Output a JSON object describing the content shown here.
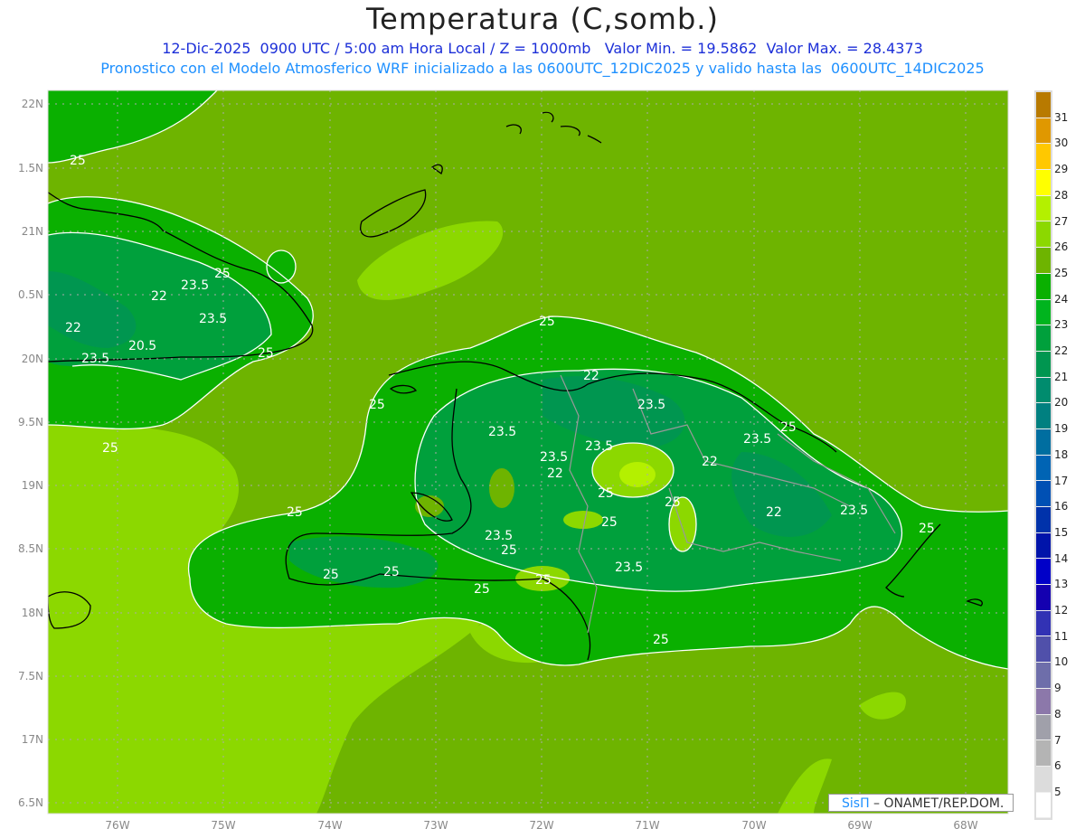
{
  "header": {
    "title": "Temperatura (C,somb.)",
    "line1": "12-Dic-2025  0900 UTC / 5:00 am Hora Local / Z = 1000mb   Valor Min. = 19.5862  Valor Max. = 28.4373",
    "line2": "Pronostico con el Modelo Atmosferico WRF inicializado a las 0600UTC_12DIC2025 y valido hasta las  0600UTC_14DIC2025"
  },
  "map": {
    "lat_labels": [
      "22N",
      "1.5N",
      "21N",
      "0.5N",
      "20N",
      "9.5N",
      "19N",
      "8.5N",
      "18N",
      "7.5N",
      "17N",
      "6.5N"
    ],
    "lon_labels": [
      "76W",
      "75W",
      "74W",
      "73W",
      "72W",
      "71W",
      "70W",
      "69W",
      "68W"
    ],
    "contour_labels": [
      "25",
      "25",
      "22",
      "23.5",
      "23.5",
      "22",
      "20.5",
      "23.5",
      "25",
      "25",
      "25",
      "25",
      "22",
      "23.5",
      "23.5",
      "23.5",
      "23.5",
      "25",
      "22",
      "22",
      "25",
      "25",
      "23.5",
      "25",
      "25",
      "22",
      "23.5",
      "23.5",
      "25",
      "25",
      "25",
      "25",
      "23.5",
      "25",
      "25",
      "25"
    ],
    "colors": {
      "ocean_base": "#6eb400",
      "light": "#8cd800",
      "c24": "#0ab000",
      "c23": "#00b41e",
      "c22": "#00a03c",
      "c21": "#009650",
      "c20": "#008c6e",
      "warm": "#b4f000"
    }
  },
  "colorbar": {
    "labels": [
      "31",
      "30",
      "29",
      "28",
      "27",
      "26",
      "25",
      "24",
      "23",
      "22",
      "21",
      "20",
      "19",
      "18",
      "17",
      "16",
      "15",
      "14",
      "13",
      "12",
      "11",
      "10",
      "9",
      "8",
      "7",
      "6",
      "5"
    ],
    "colors": [
      "#b87a00",
      "#e09800",
      "#ffc800",
      "#ffff00",
      "#b4f000",
      "#8cd800",
      "#6eb400",
      "#0ab000",
      "#00b41e",
      "#00a03c",
      "#009650",
      "#008c6e",
      "#008080",
      "#006ea0",
      "#0064b4",
      "#0050b4",
      "#0032aa",
      "#0014aa",
      "#0000c8",
      "#1400b0",
      "#3232b4",
      "#5050aa",
      "#6e6eaa",
      "#8c78aa",
      "#a0a0aa",
      "#b4b4b4",
      "#dcdcdc",
      "#ffffff"
    ]
  },
  "credit": {
    "sis": "SisΠ",
    "text": " – ONAMET/REP.DOM."
  }
}
